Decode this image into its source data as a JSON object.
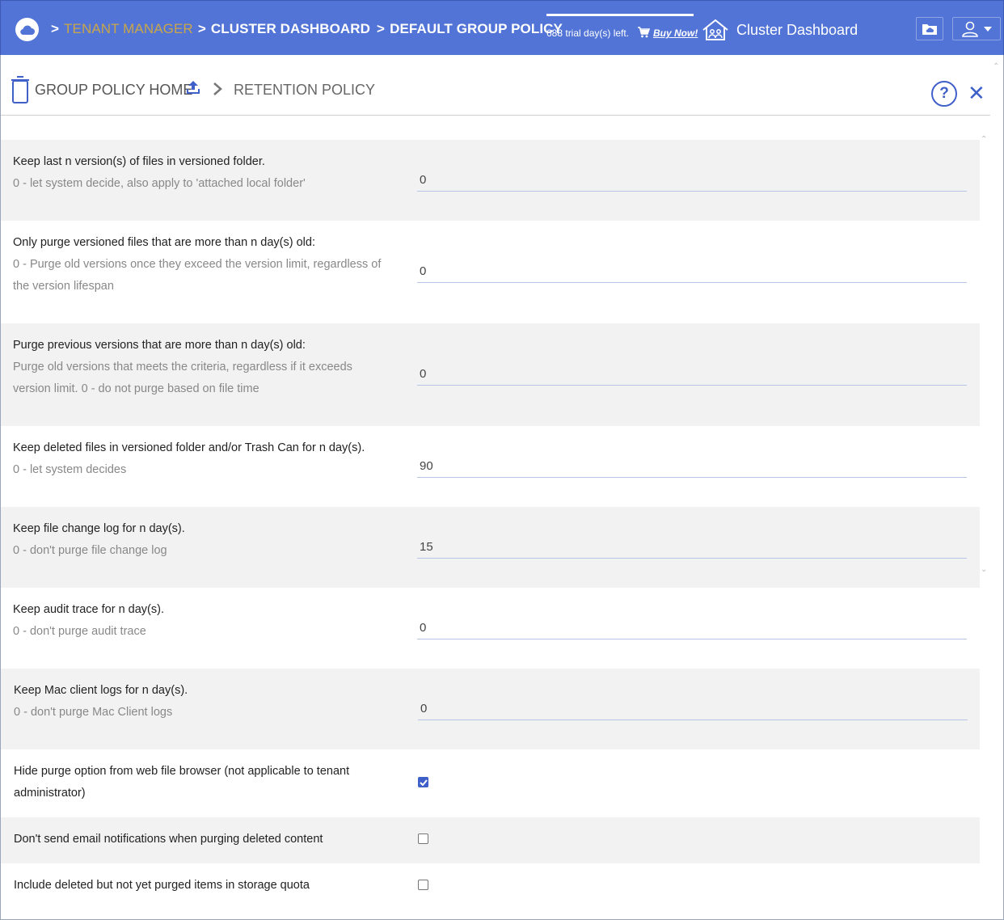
{
  "header": {
    "breadcrumb": [
      {
        "label": "TENANT MANAGER"
      },
      {
        "label": "CLUSTER DASHBOARD"
      },
      {
        "label": "DEFAULT GROUP POLICY"
      }
    ],
    "separator": ">",
    "trial_text": "688 trial day(s) left.",
    "buy_label": "Buy Now!",
    "cluster_title": "Cluster Dashboard"
  },
  "subheader": {
    "home_label": "GROUP POLICY HOME",
    "current_label": "RETENTION POLICY",
    "help_glyph": "?",
    "close_glyph": "✕"
  },
  "settings": [
    {
      "label": "Keep last n version(s) of files in versioned folder.",
      "hint": "0 - let system decide, also apply to 'attached local folder'",
      "value": "0"
    },
    {
      "label": "Only purge versioned files that are more than n day(s) old:",
      "hint": "0 - Purge old versions once they exceed the version limit, regardless of the version lifespan",
      "value": "0"
    },
    {
      "label": "Purge previous versions that are more than n day(s) old:",
      "hint": "Purge old versions that meets the criteria, regardless if it exceeds version limit. 0 - do not purge based on file time",
      "value": "0"
    },
    {
      "label": "Keep deleted files in versioned folder and/or Trash Can for n day(s).",
      "hint": "0 - let system decides",
      "value": "90"
    },
    {
      "label": "Keep file change log for n day(s).",
      "hint": "0 - don't purge file change log",
      "value": "15"
    },
    {
      "label": "Keep audit trace for n day(s).",
      "hint": "0 - don't purge audit trace",
      "value": "0"
    },
    {
      "label": "Keep Mac client logs for n day(s).",
      "hint": "0 - don't purge Mac Client logs",
      "value": "0"
    }
  ],
  "checkboxes": [
    {
      "label": "Hide purge option from web file browser (not applicable to tenant administrator)",
      "checked": true
    },
    {
      "label": "Don't send email notifications when purging deleted content",
      "checked": false
    },
    {
      "label": "Include deleted but not yet purged items in storage quota",
      "checked": false
    }
  ],
  "colors": {
    "header_bg": "#5274d6",
    "accent": "#3f5fc9",
    "tenant_link": "#c9a64a",
    "row_alt": "#f2f2f2"
  }
}
